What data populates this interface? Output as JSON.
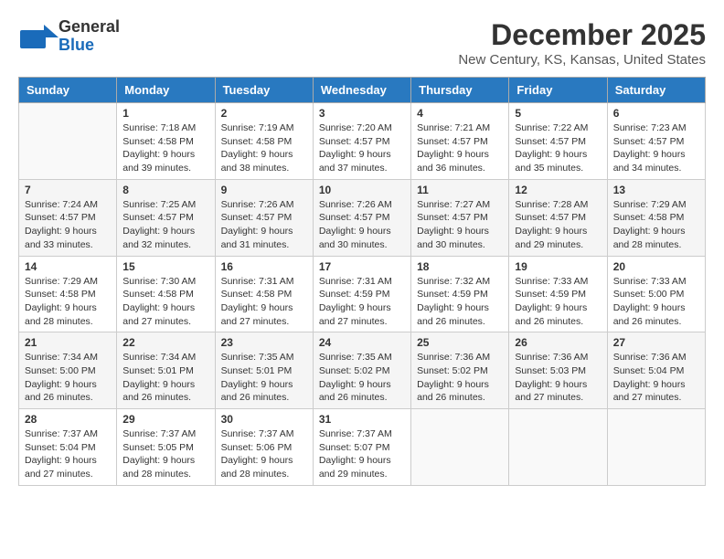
{
  "header": {
    "logo_general": "General",
    "logo_blue": "Blue",
    "month_title": "December 2025",
    "location": "New Century, KS, Kansas, United States"
  },
  "days_of_week": [
    "Sunday",
    "Monday",
    "Tuesday",
    "Wednesday",
    "Thursday",
    "Friday",
    "Saturday"
  ],
  "weeks": [
    [
      {
        "day": "",
        "info": ""
      },
      {
        "day": "1",
        "info": "Sunrise: 7:18 AM\nSunset: 4:58 PM\nDaylight: 9 hours\nand 39 minutes."
      },
      {
        "day": "2",
        "info": "Sunrise: 7:19 AM\nSunset: 4:58 PM\nDaylight: 9 hours\nand 38 minutes."
      },
      {
        "day": "3",
        "info": "Sunrise: 7:20 AM\nSunset: 4:57 PM\nDaylight: 9 hours\nand 37 minutes."
      },
      {
        "day": "4",
        "info": "Sunrise: 7:21 AM\nSunset: 4:57 PM\nDaylight: 9 hours\nand 36 minutes."
      },
      {
        "day": "5",
        "info": "Sunrise: 7:22 AM\nSunset: 4:57 PM\nDaylight: 9 hours\nand 35 minutes."
      },
      {
        "day": "6",
        "info": "Sunrise: 7:23 AM\nSunset: 4:57 PM\nDaylight: 9 hours\nand 34 minutes."
      }
    ],
    [
      {
        "day": "7",
        "info": "Sunrise: 7:24 AM\nSunset: 4:57 PM\nDaylight: 9 hours\nand 33 minutes."
      },
      {
        "day": "8",
        "info": "Sunrise: 7:25 AM\nSunset: 4:57 PM\nDaylight: 9 hours\nand 32 minutes."
      },
      {
        "day": "9",
        "info": "Sunrise: 7:26 AM\nSunset: 4:57 PM\nDaylight: 9 hours\nand 31 minutes."
      },
      {
        "day": "10",
        "info": "Sunrise: 7:26 AM\nSunset: 4:57 PM\nDaylight: 9 hours\nand 30 minutes."
      },
      {
        "day": "11",
        "info": "Sunrise: 7:27 AM\nSunset: 4:57 PM\nDaylight: 9 hours\nand 30 minutes."
      },
      {
        "day": "12",
        "info": "Sunrise: 7:28 AM\nSunset: 4:57 PM\nDaylight: 9 hours\nand 29 minutes."
      },
      {
        "day": "13",
        "info": "Sunrise: 7:29 AM\nSunset: 4:58 PM\nDaylight: 9 hours\nand 28 minutes."
      }
    ],
    [
      {
        "day": "14",
        "info": "Sunrise: 7:29 AM\nSunset: 4:58 PM\nDaylight: 9 hours\nand 28 minutes."
      },
      {
        "day": "15",
        "info": "Sunrise: 7:30 AM\nSunset: 4:58 PM\nDaylight: 9 hours\nand 27 minutes."
      },
      {
        "day": "16",
        "info": "Sunrise: 7:31 AM\nSunset: 4:58 PM\nDaylight: 9 hours\nand 27 minutes."
      },
      {
        "day": "17",
        "info": "Sunrise: 7:31 AM\nSunset: 4:59 PM\nDaylight: 9 hours\nand 27 minutes."
      },
      {
        "day": "18",
        "info": "Sunrise: 7:32 AM\nSunset: 4:59 PM\nDaylight: 9 hours\nand 26 minutes."
      },
      {
        "day": "19",
        "info": "Sunrise: 7:33 AM\nSunset: 4:59 PM\nDaylight: 9 hours\nand 26 minutes."
      },
      {
        "day": "20",
        "info": "Sunrise: 7:33 AM\nSunset: 5:00 PM\nDaylight: 9 hours\nand 26 minutes."
      }
    ],
    [
      {
        "day": "21",
        "info": "Sunrise: 7:34 AM\nSunset: 5:00 PM\nDaylight: 9 hours\nand 26 minutes."
      },
      {
        "day": "22",
        "info": "Sunrise: 7:34 AM\nSunset: 5:01 PM\nDaylight: 9 hours\nand 26 minutes."
      },
      {
        "day": "23",
        "info": "Sunrise: 7:35 AM\nSunset: 5:01 PM\nDaylight: 9 hours\nand 26 minutes."
      },
      {
        "day": "24",
        "info": "Sunrise: 7:35 AM\nSunset: 5:02 PM\nDaylight: 9 hours\nand 26 minutes."
      },
      {
        "day": "25",
        "info": "Sunrise: 7:36 AM\nSunset: 5:02 PM\nDaylight: 9 hours\nand 26 minutes."
      },
      {
        "day": "26",
        "info": "Sunrise: 7:36 AM\nSunset: 5:03 PM\nDaylight: 9 hours\nand 27 minutes."
      },
      {
        "day": "27",
        "info": "Sunrise: 7:36 AM\nSunset: 5:04 PM\nDaylight: 9 hours\nand 27 minutes."
      }
    ],
    [
      {
        "day": "28",
        "info": "Sunrise: 7:37 AM\nSunset: 5:04 PM\nDaylight: 9 hours\nand 27 minutes."
      },
      {
        "day": "29",
        "info": "Sunrise: 7:37 AM\nSunset: 5:05 PM\nDaylight: 9 hours\nand 28 minutes."
      },
      {
        "day": "30",
        "info": "Sunrise: 7:37 AM\nSunset: 5:06 PM\nDaylight: 9 hours\nand 28 minutes."
      },
      {
        "day": "31",
        "info": "Sunrise: 7:37 AM\nSunset: 5:07 PM\nDaylight: 9 hours\nand 29 minutes."
      },
      {
        "day": "",
        "info": ""
      },
      {
        "day": "",
        "info": ""
      },
      {
        "day": "",
        "info": ""
      }
    ]
  ]
}
